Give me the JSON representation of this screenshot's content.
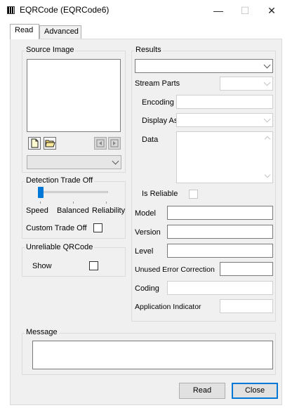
{
  "window": {
    "title": "EQRCode (EQRCode6)",
    "minimize_glyph": "—",
    "maximize_glyph": "☐",
    "close_glyph": "✕"
  },
  "tabs": [
    {
      "label": "Read",
      "active": true
    },
    {
      "label": "Advanced",
      "active": false
    }
  ],
  "source_image": {
    "legend": "Source Image",
    "buttons": [
      "new-document-icon",
      "open-folder-icon",
      "previous-icon",
      "next-icon"
    ],
    "dropdown_value": ""
  },
  "detection": {
    "legend": "Detection Trade Off",
    "slider_position": 0,
    "labels": [
      "Speed",
      "Balanced",
      "Reliability"
    ],
    "custom_label": "Custom Trade Off",
    "custom_checked": false
  },
  "unreliable": {
    "legend": "Unreliable QRCode",
    "show_label": "Show",
    "show_checked": false
  },
  "results": {
    "legend": "Results",
    "dropdown_value": "",
    "stream_parts_label": "Stream Parts",
    "encoding_label": "Encoding",
    "display_as_label": "Display As",
    "data_label": "Data",
    "is_reliable_label": "Is Reliable",
    "model_label": "Model",
    "version_label": "Version",
    "level_label": "Level",
    "unused_ec_label": "Unused Error Correction",
    "coding_label": "Coding",
    "app_indicator_label": "Application Indicator"
  },
  "message": {
    "legend": "Message",
    "text": ""
  },
  "footer": {
    "read_label": "Read",
    "close_label": "Close"
  },
  "colors": {
    "dialog_bg": "#f0f0f0",
    "accent": "#0078d7",
    "slider_thumb": "#0078d7"
  }
}
